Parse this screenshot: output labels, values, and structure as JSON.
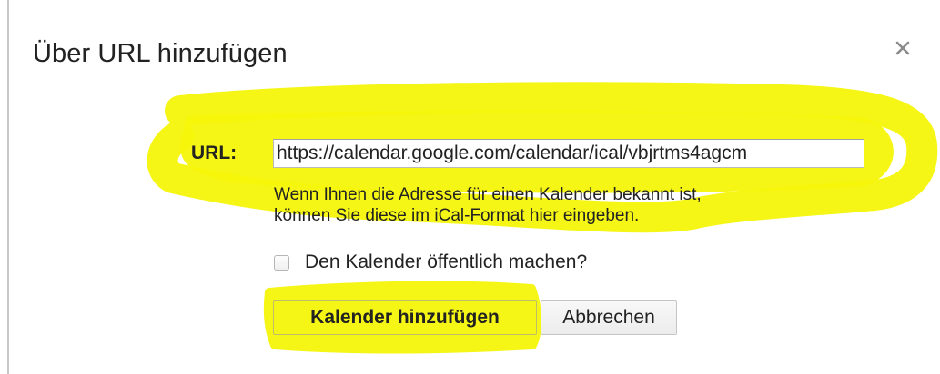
{
  "dialog": {
    "title": "Über URL hinzufügen",
    "close_icon": "close-icon"
  },
  "form": {
    "url_label": "URL:",
    "url_value": "https://calendar.google.com/calendar/ical/vbjrtms4agcm",
    "hint_line_1": "Wenn Ihnen die Adresse für einen Kalender bekannt ist,",
    "hint_line_2": "können Sie diese im iCal-Format hier eingeben.",
    "public_checkbox_label": "Den Kalender öffentlich machen?",
    "public_checked": false
  },
  "buttons": {
    "add_label": "Kalender hinzufügen",
    "cancel_label": "Abbrechen"
  },
  "colors": {
    "highlight": "#f5f50a",
    "text": "#222222",
    "close_icon": "#8a8a8a"
  }
}
